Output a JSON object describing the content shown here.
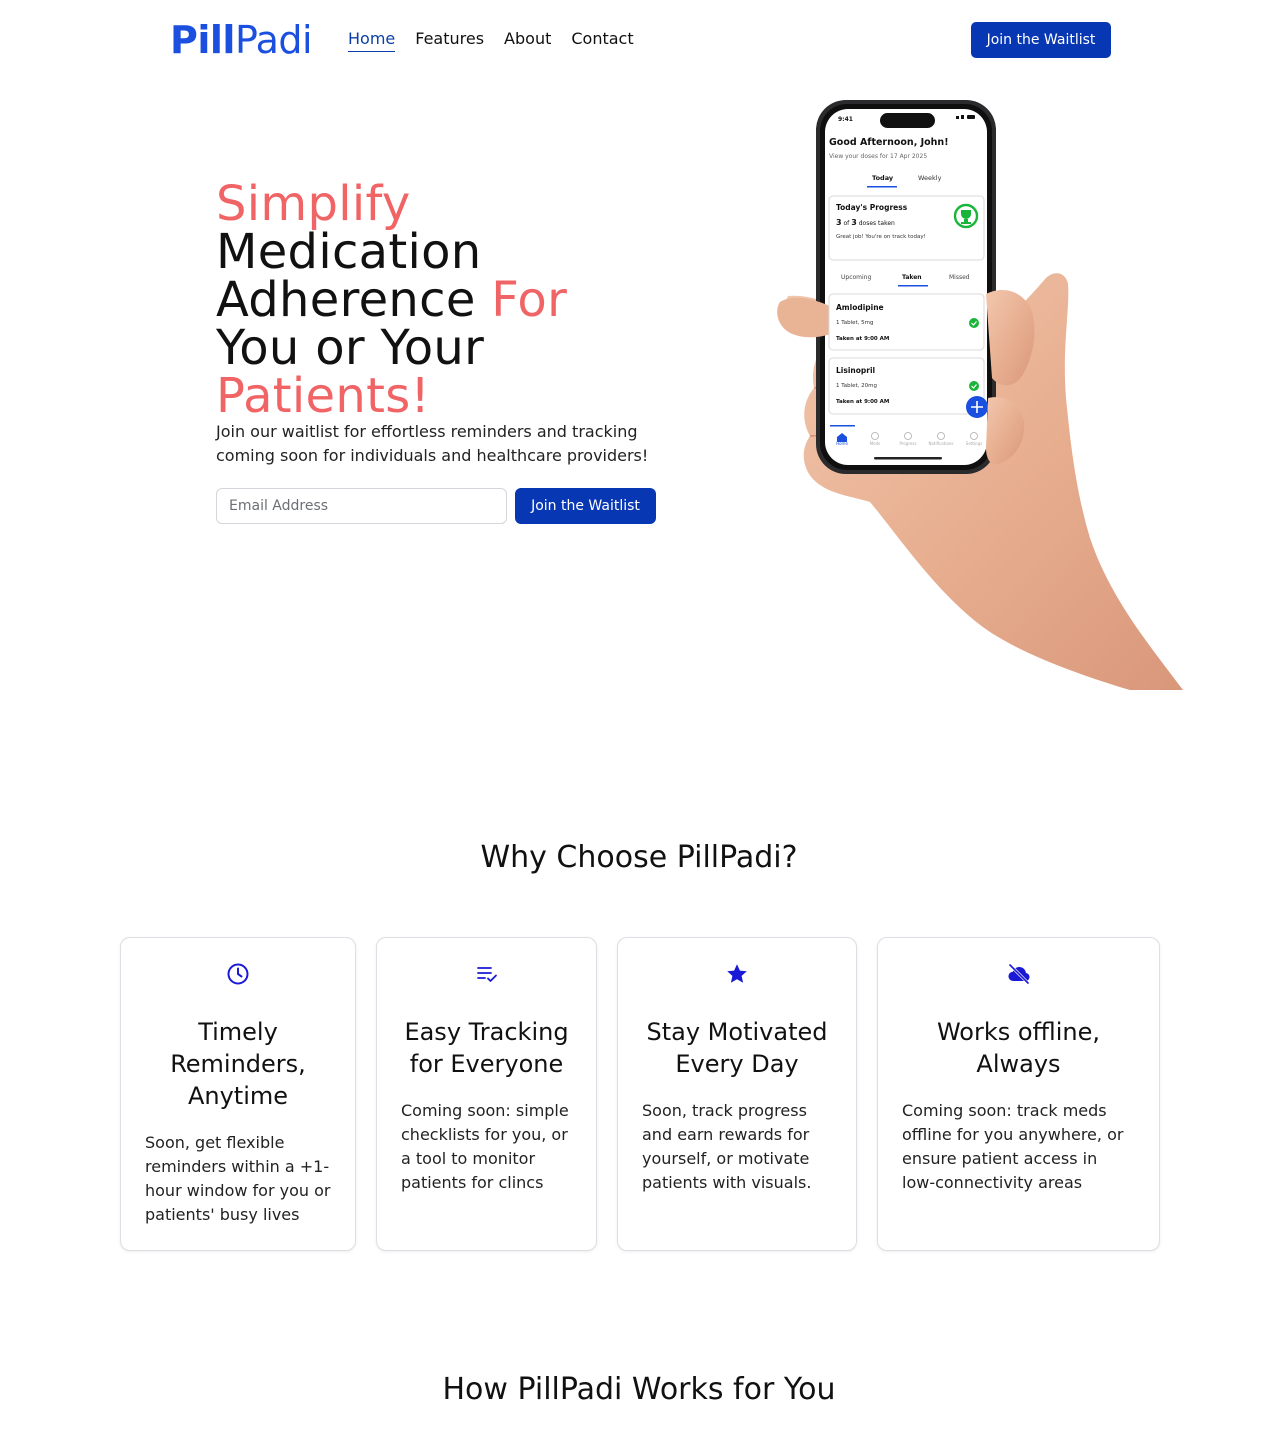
{
  "brand": {
    "logo_bold": "Pill",
    "logo_light": "Padi",
    "primary_color": "#0837b3",
    "accent_color": "#f06466",
    "logo_color": "#1a4fe0"
  },
  "nav": {
    "items": [
      {
        "label": "Home",
        "active": true
      },
      {
        "label": "Features"
      },
      {
        "label": "About"
      },
      {
        "label": "Contact"
      }
    ],
    "cta": "Join the Waitlist"
  },
  "hero": {
    "title_parts": [
      "Simplify",
      "Medication",
      "Adherence",
      "For",
      "You or Your",
      "Patients!"
    ],
    "subtitle": "Join our waitlist for effortless reminders and tracking coming soon for individuals and healthcare providers!",
    "email_placeholder": "Email Address",
    "cta": "Join the Waitlist",
    "phone": {
      "time": "9:41",
      "greeting": "Good Afternoon, John!",
      "date_line": "View your doses for 17 Apr 2025",
      "tabs": [
        "Today",
        "Weekly"
      ],
      "progress_title": "Today's Progress",
      "progress_taken": "3",
      "progress_of": "of",
      "progress_total": "3",
      "progress_suffix": "doses taken",
      "progress_note": "Great job! You're on track today!",
      "dose_tabs": [
        "Upcoming",
        "Taken",
        "Missed"
      ],
      "doses": [
        {
          "name": "Amlodipine",
          "detail": "1 Tablet, 5mg",
          "status": "Taken at 9:00 AM"
        },
        {
          "name": "Lisinopril",
          "detail": "1 Tablet, 20mg",
          "status": "Taken at 9:00 AM"
        }
      ],
      "bottom_nav": [
        "Home",
        "Meds",
        "Progress",
        "Notifications",
        "Settings"
      ]
    }
  },
  "features": {
    "title": "Why Choose PillPadi?",
    "cards": [
      {
        "icon": "clock-icon",
        "title": "Timely Reminders, Anytime",
        "text": "Soon, get flexible reminders within a +1-hour window for you or patients' busy lives"
      },
      {
        "icon": "checklist-icon",
        "title": "Easy Tracking for Everyone",
        "text": "Coming soon: simple checklists for you, or a tool to monitor patients for clincs"
      },
      {
        "icon": "star-icon",
        "title": "Stay Motivated Every Day",
        "text": "Soon, track progress and earn rewards for yourself, or motivate patients with visuals."
      },
      {
        "icon": "cloud-off-icon",
        "title": "Works offline, Always",
        "text": "Coming soon: track meds offline for you anywhere, or ensure patient access in low-connectivity areas"
      }
    ]
  },
  "how": {
    "title": "How PillPadi Works for You"
  }
}
